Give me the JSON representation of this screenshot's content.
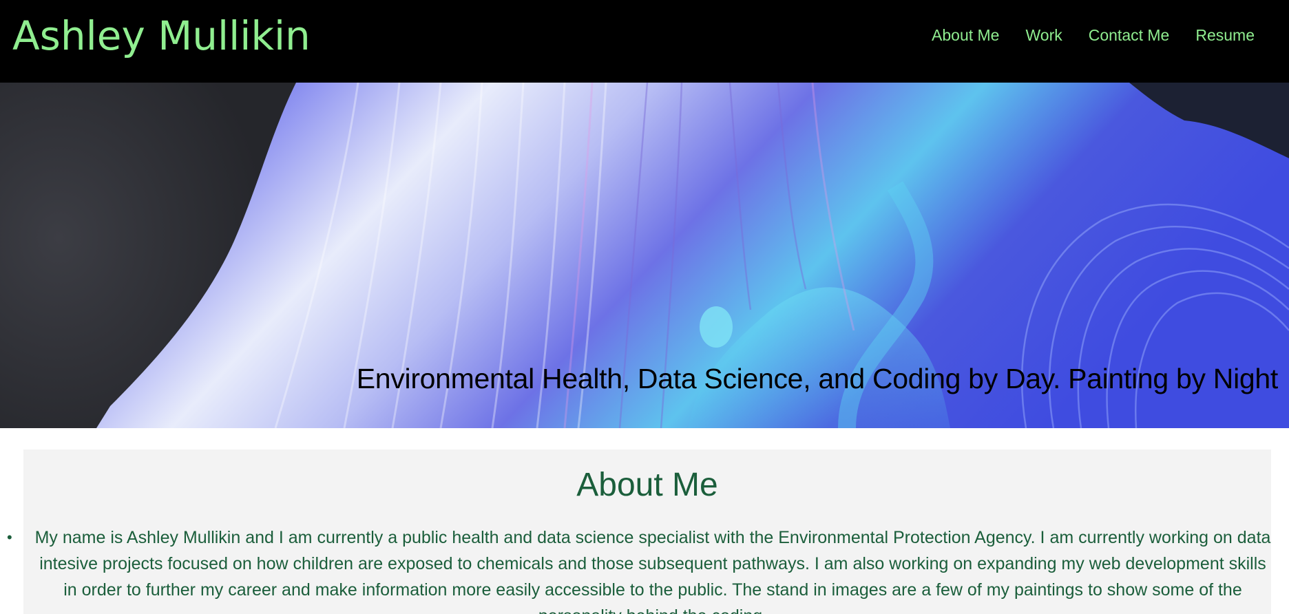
{
  "header": {
    "site_title": "Ashley Mullikin",
    "nav": [
      {
        "label": "About Me"
      },
      {
        "label": "Work"
      },
      {
        "label": "Contact Me"
      },
      {
        "label": "Resume"
      }
    ]
  },
  "hero": {
    "tagline": "Environmental Health, Data Science, and Coding by Day. Painting by Night"
  },
  "about": {
    "heading": "About Me",
    "items": [
      {
        "text": "My name is Ashley Mullikin and I am currently a public health and data science specialist with the Environmental Protection Agency. I am currently working on data intesive projects focused on how children are exposed to chemicals and those subsequent pathways. I am also working on expanding my web development skills in order to further my career and make information more easily accessible to the public. The stand in images are a few of my paintings to show some of the personality behind the coding."
      }
    ]
  },
  "colors": {
    "header_bg": "#000000",
    "accent_green": "#90ee90",
    "text_dark_green": "#1b5e3b",
    "section_bg": "#f3f3f3"
  }
}
